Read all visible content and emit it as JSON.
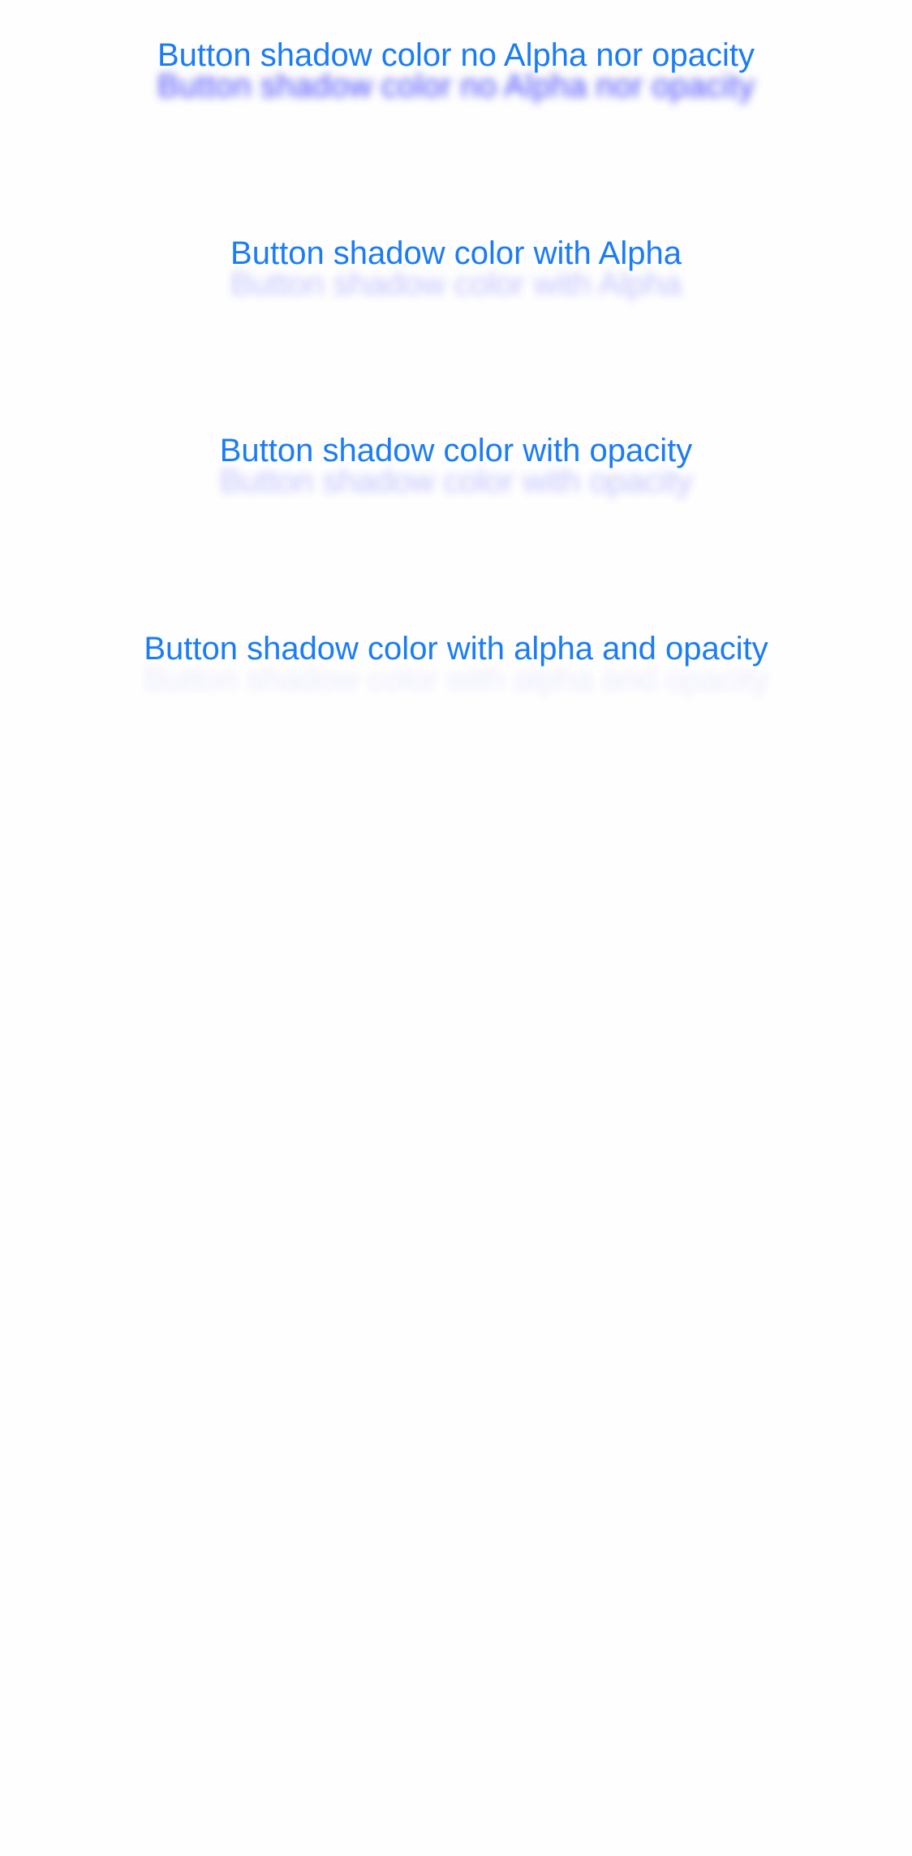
{
  "buttons": [
    {
      "label": "Button shadow color no Alpha nor opacity"
    },
    {
      "label": "Button shadow color with Alpha"
    },
    {
      "label": "Button shadow color with opacity"
    },
    {
      "label": "Button shadow color with alpha and opacity"
    }
  ],
  "colors": {
    "background": "#fefefe",
    "button_text": "#1a7cf6",
    "shadow": "#3c3cff"
  }
}
